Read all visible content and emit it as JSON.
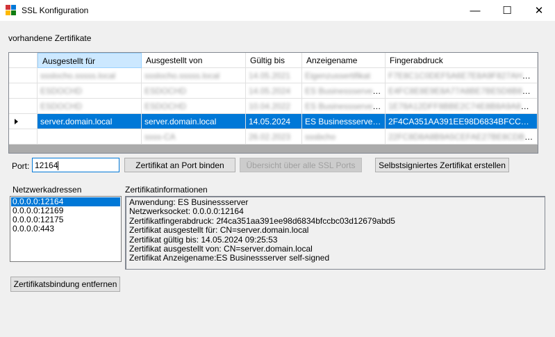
{
  "window": {
    "title": "SSL Konfiguration",
    "minimize_glyph": "—",
    "maximize_glyph": "☐",
    "close_glyph": "✕"
  },
  "certificates_label": "vorhandene Zertifikate",
  "grid": {
    "columns": [
      "Ausgestellt für",
      "Ausgestellt von",
      "Gültig bis",
      "Anzeigename",
      "Fingerabdruck"
    ],
    "selected_column": 0,
    "rows": [
      {
        "cells": [
          "ssslocho.sssss.local",
          "ssslocho.sssss.local",
          "14.05.2021",
          "Eigenzussertifikat",
          "F7E8C1C0DEF5A6E7E8A9F827AH0D0A..."
        ],
        "blurred": true,
        "selected": false
      },
      {
        "cells": [
          "ESDOCHD",
          "ESDOCHD",
          "14.05.2024",
          "ES Businessserver se...",
          "E4FC8E8E9E8A77A8BE7BE5D8B8DBA..."
        ],
        "blurred": true,
        "selected": false
      },
      {
        "cells": [
          "ESDOCHD",
          "ESDOCHD",
          "10.04.2022",
          "ES Businessserver se...",
          "1E78A12DFF8BBE2C74E8B8A9A8E3B..."
        ],
        "blurred": true,
        "selected": false
      },
      {
        "cells": [
          "server.domain.local",
          "server.domain.local",
          "14.05.2024",
          "ES Businessserver se...",
          "2F4CA351AA391EE98D6834BFCCBC03D..."
        ],
        "blurred": false,
        "selected": true
      },
      {
        "cells": [
          "",
          "ssss-CA",
          "26.02.2023",
          "sssbcho",
          "22FC8D8A8B9A5CEFAE27BE8CDBC8E..."
        ],
        "blurred": true,
        "selected": false
      }
    ]
  },
  "port": {
    "label": "Port:",
    "value": "12164"
  },
  "buttons": {
    "bind": "Zertifikat an Port binden",
    "overview": "Übersicht über alle SSL Ports",
    "self_signed": "Selbstsigniertes Zertifikat erstellen",
    "remove_binding": "Zertifikatsbindung entfernen"
  },
  "network": {
    "label": "Netzwerkadressen",
    "items": [
      "0.0.0.0:12164",
      "0.0.0.0:12169",
      "0.0.0.0:12175",
      "0.0.0.0:443"
    ],
    "selected_index": 0
  },
  "cert_info": {
    "label": "Zertifikatinformationen",
    "lines": [
      "Anwendung: ES Businessserver",
      "Netzwerksocket: 0.0.0.0:12164",
      "Zertifikatfingerabdruck: 2f4ca351aa391ee98d6834bfccbc03d12679abd5",
      "Zertifikat ausgestellt für: CN=server.domain.local",
      "Zertifikat gültig bis: 14.05.2024 09:25:53",
      "Zertifikat ausgestellt von: CN=server.domain.local",
      "Zertifikat Anzeigename:ES Businessserver self-signed"
    ]
  },
  "colors": {
    "selection": "#0078d7",
    "header_selected": "#cce8ff",
    "grid_background": "#ababab"
  }
}
